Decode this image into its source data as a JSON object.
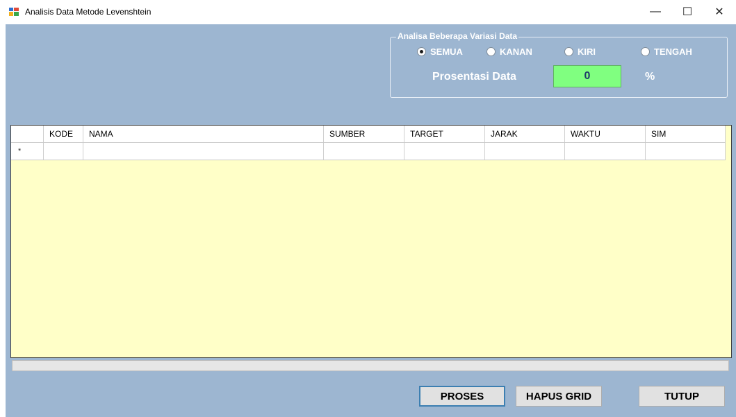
{
  "window": {
    "title": "Analisis Data Metode Levenshtein",
    "minimize_glyph": "—",
    "maximize_glyph": "☐",
    "close_glyph": "✕"
  },
  "analysis": {
    "group_label": "Analisa Beberapa Variasi  Data",
    "options": [
      {
        "label": "SEMUA",
        "checked": true
      },
      {
        "label": "KANAN",
        "checked": false
      },
      {
        "label": "KIRI",
        "checked": false
      },
      {
        "label": "TENGAH",
        "checked": false
      }
    ],
    "percentage_label": "Prosentasi Data",
    "percentage_value": "0",
    "percentage_unit": "%"
  },
  "grid": {
    "columns": [
      "KODE",
      "NAMA",
      "SUMBER",
      "TARGET",
      "JARAK",
      "WAKTU",
      "SIM"
    ],
    "new_row_marker": "*"
  },
  "progress": {
    "value": 0
  },
  "buttons": {
    "proses": "PROSES",
    "hapus": "HAPUS GRID",
    "tutup": "TUTUP"
  },
  "colors": {
    "client_bg": "#9db6d1",
    "grid_bg": "#ffffc8",
    "percentage_bg": "#80ff80"
  }
}
